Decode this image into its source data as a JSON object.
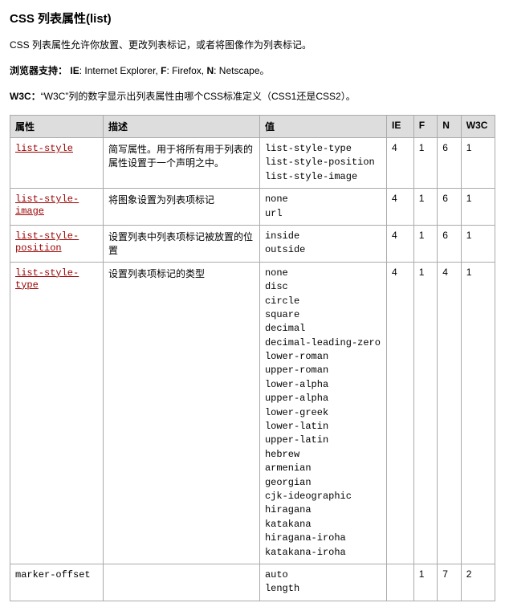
{
  "heading": "CSS 列表属性(list)",
  "intro": "CSS 列表属性允许你放置、更改列表标记，或者将图像作为列表标记。",
  "browser_label": "浏览器支持：",
  "browser_ie_b": "IE",
  "browser_ie_t": ": Internet Explorer, ",
  "browser_f_b": "F",
  "browser_f_t": ": Firefox, ",
  "browser_n_b": "N",
  "browser_n_t": ": Netscape。",
  "w3c_label": "W3C：",
  "w3c_text": "“W3C”列的数字显示出列表属性由哪个CSS标准定义（CSS1还是CSS2）。",
  "th": {
    "prop": "属性",
    "desc": "描述",
    "val": "值",
    "ie": "IE",
    "f": "F",
    "n": "N",
    "w3c": "W3C"
  },
  "rows": [
    {
      "prop": "list-style",
      "link": true,
      "desc": "简写属性。用于将所有用于列表的属性设置于一个声明之中。",
      "vals": "list-style-type\nlist-style-position\nlist-style-image",
      "ie": "4",
      "f": "1",
      "n": "6",
      "w3c": "1"
    },
    {
      "prop": "list-style-image",
      "link": true,
      "desc": "将图象设置为列表项标记",
      "vals": "none\nurl",
      "ie": "4",
      "f": "1",
      "n": "6",
      "w3c": "1"
    },
    {
      "prop": "list-style-position",
      "link": true,
      "desc": "设置列表中列表项标记被放置的位置",
      "vals": "inside\noutside",
      "ie": "4",
      "f": "1",
      "n": "6",
      "w3c": "1"
    },
    {
      "prop": "list-style-type",
      "link": true,
      "desc": "设置列表项标记的类型",
      "vals": "none\ndisc\ncircle\nsquare\ndecimal\ndecimal-leading-zero\nlower-roman\nupper-roman\nlower-alpha\nupper-alpha\nlower-greek\nlower-latin\nupper-latin\nhebrew\narmenian\ngeorgian\ncjk-ideographic\nhiragana\nkatakana\nhiragana-iroha\nkatakana-iroha",
      "ie": "4",
      "f": "1",
      "n": "4",
      "w3c": "1"
    },
    {
      "prop": "marker-offset",
      "link": false,
      "desc": "",
      "vals": "auto\nlength",
      "ie": "",
      "f": "1",
      "n": "7",
      "w3c": "2"
    }
  ]
}
